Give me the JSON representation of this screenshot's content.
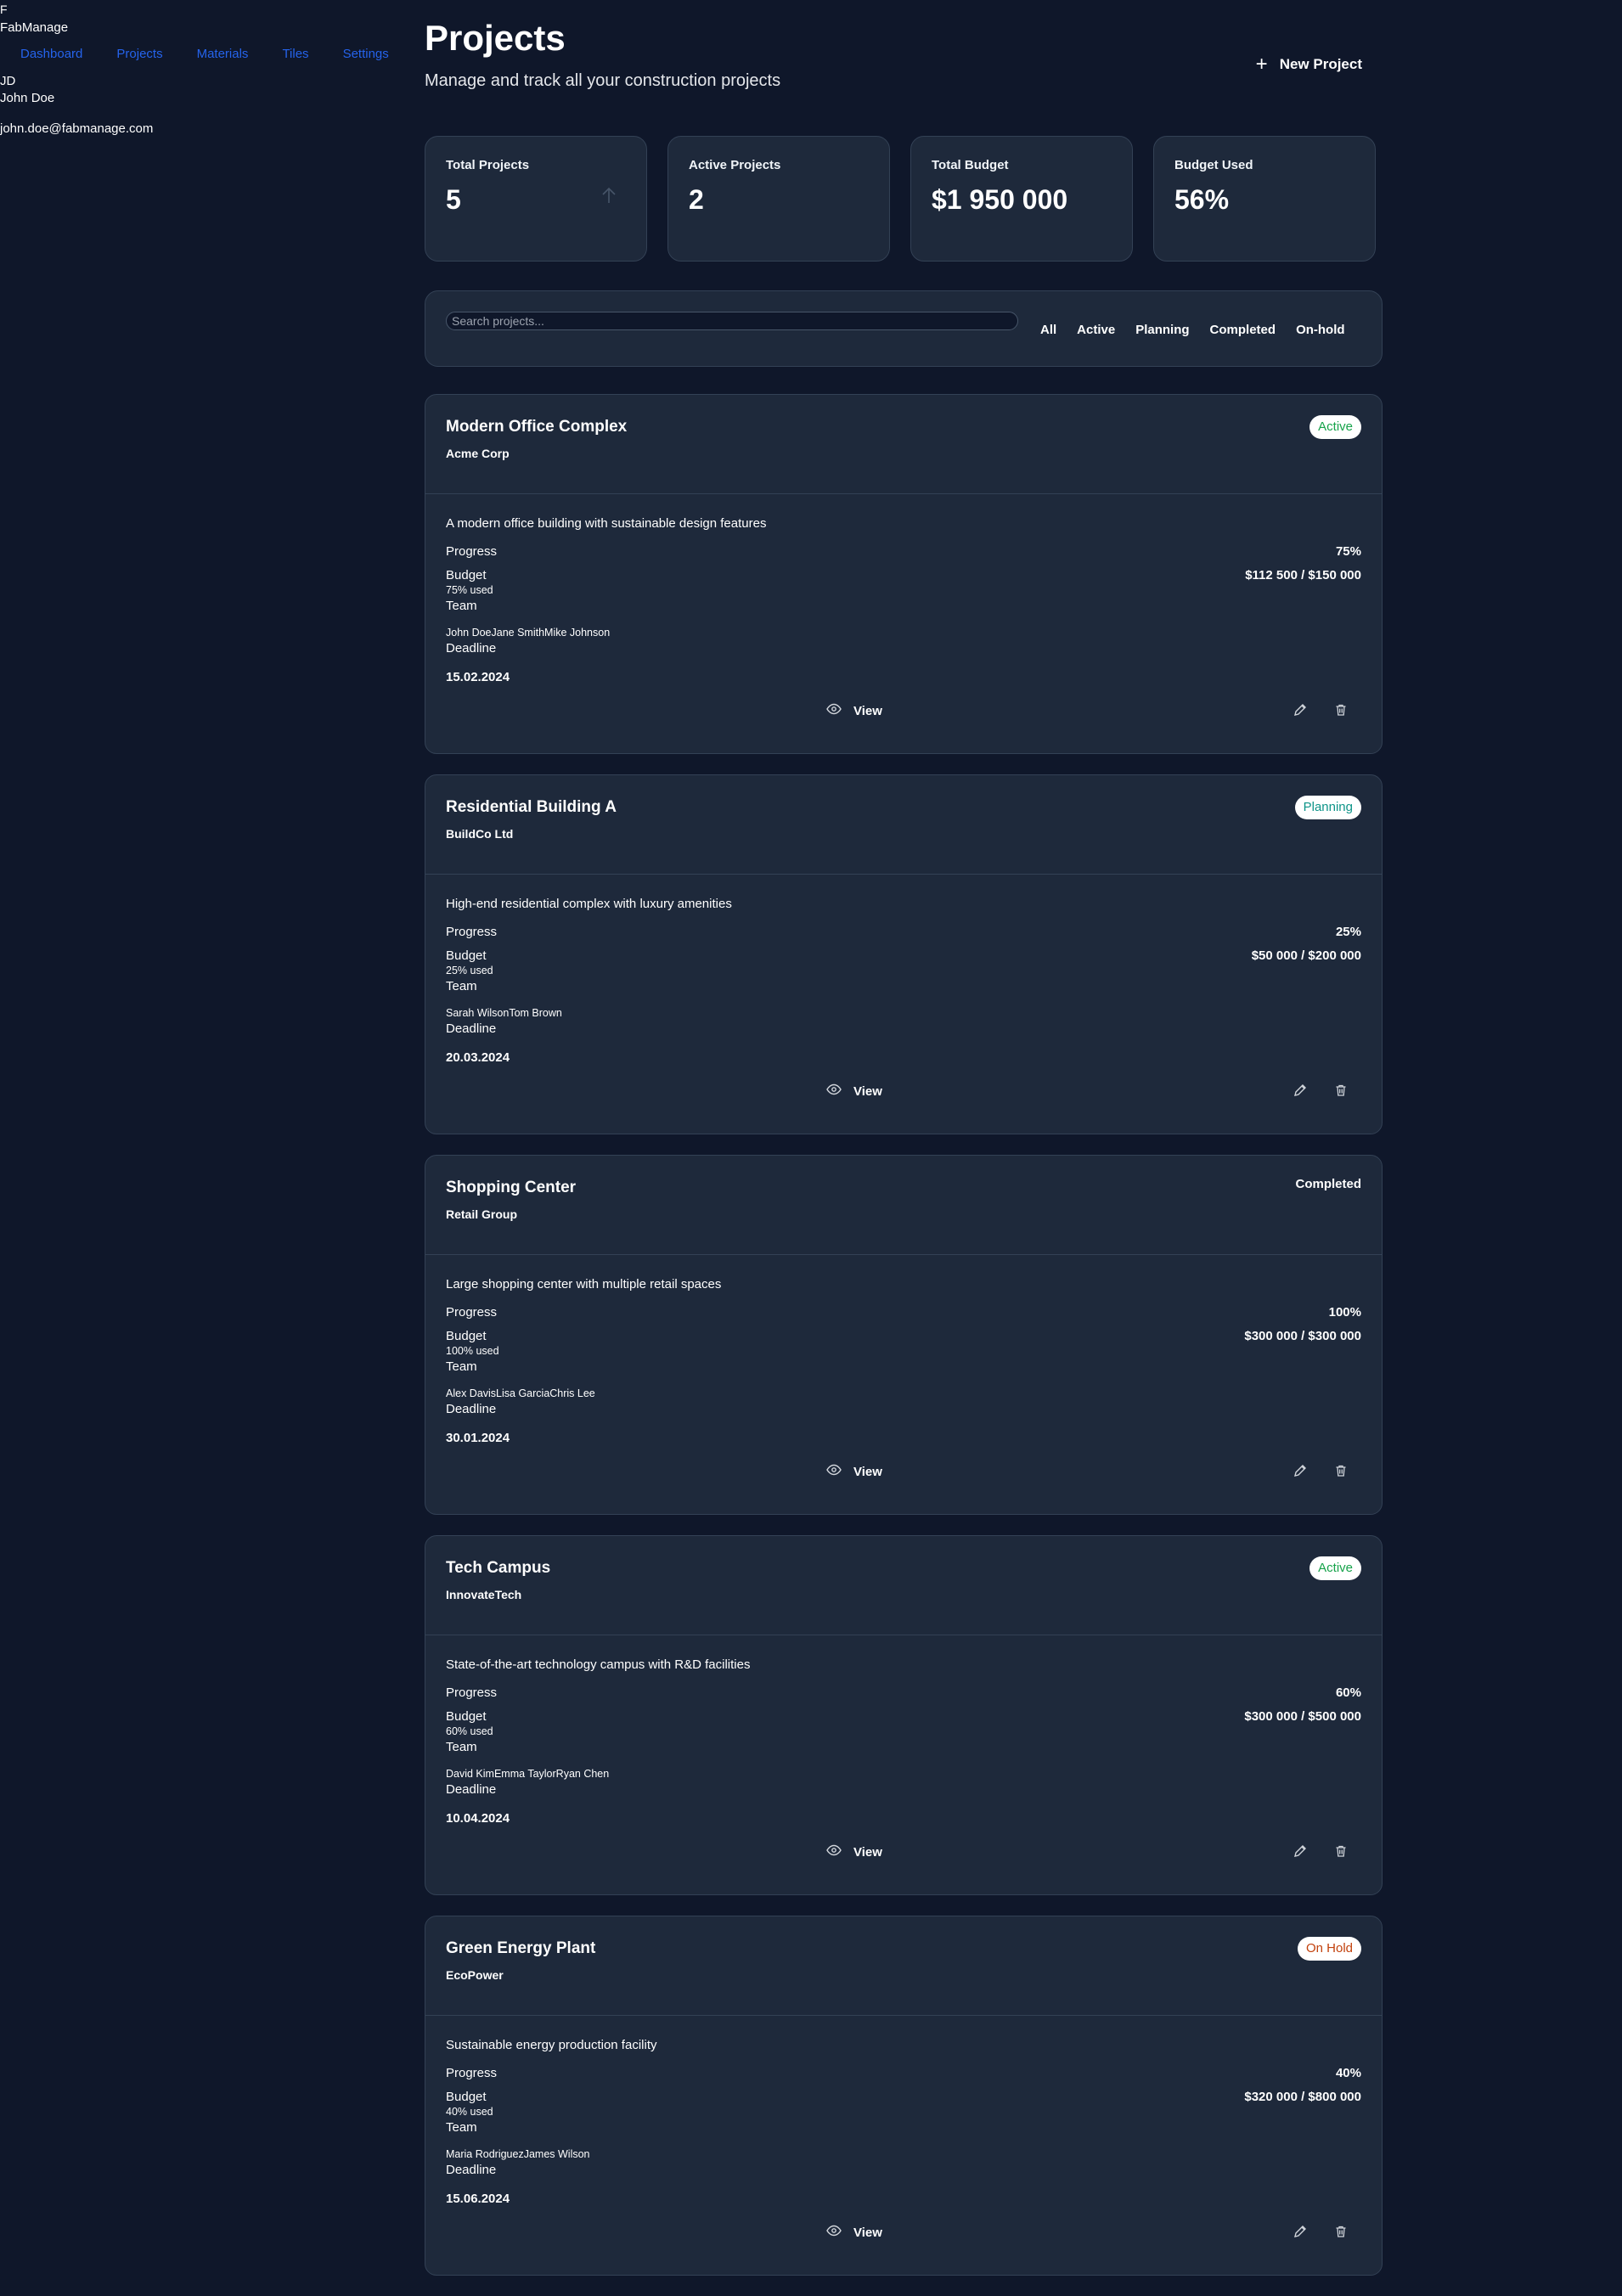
{
  "app": {
    "logo_letter": "F",
    "name": "FabManage"
  },
  "nav": {
    "items": [
      {
        "label": "Dashboard"
      },
      {
        "label": "Projects"
      },
      {
        "label": "Materials"
      },
      {
        "label": "Tiles"
      },
      {
        "label": "Settings"
      }
    ]
  },
  "user": {
    "initials": "JD",
    "name": "John Doe",
    "email": "john.doe@fabmanage.com"
  },
  "header": {
    "title": "Projects",
    "subtitle": "Manage and track all your construction projects",
    "new_button_label": "New Project",
    "new_button_icon": "plus-icon"
  },
  "stats": [
    {
      "label": "Total Projects",
      "value": "5",
      "icon": "arrow-up-icon"
    },
    {
      "label": "Active Projects",
      "value": "2"
    },
    {
      "label": "Total Budget",
      "value": "$1 950 000"
    },
    {
      "label": "Budget Used",
      "value": "56%"
    }
  ],
  "search": {
    "placeholder": "Search projects...",
    "value": ""
  },
  "filters": [
    {
      "label": "All"
    },
    {
      "label": "Active"
    },
    {
      "label": "Planning"
    },
    {
      "label": "Completed"
    },
    {
      "label": "On-hold"
    }
  ],
  "labels": {
    "progress": "Progress",
    "budget": "Budget",
    "team": "Team",
    "deadline": "Deadline",
    "view": "View"
  },
  "colors": {
    "background": "#0f172a",
    "card": "#1e293b",
    "nav_link": "#2563eb",
    "status_active": "#16a34a",
    "status_planning": "#0d9488",
    "status_on_hold": "#c2410c"
  },
  "projects": [
    {
      "title": "Modern Office Complex",
      "client": "Acme Corp",
      "status": "Active",
      "description": "A modern office building with sustainable design features",
      "progress": "75%",
      "budget": "$112 500 / $150 000",
      "budget_used": "75% used",
      "team": "John DoeJane SmithMike Johnson",
      "deadline": "15.02.2024"
    },
    {
      "title": "Residential Building A",
      "client": "BuildCo Ltd",
      "status": "Planning",
      "description": "High-end residential complex with luxury amenities",
      "progress": "25%",
      "budget": "$50 000 / $200 000",
      "budget_used": "25% used",
      "team": "Sarah WilsonTom Brown",
      "deadline": "20.03.2024"
    },
    {
      "title": "Shopping Center",
      "client": "Retail Group",
      "status": "Completed",
      "description": "Large shopping center with multiple retail spaces",
      "progress": "100%",
      "budget": "$300 000 / $300 000",
      "budget_used": "100% used",
      "team": "Alex DavisLisa GarciaChris Lee",
      "deadline": "30.01.2024"
    },
    {
      "title": "Tech Campus",
      "client": "InnovateTech",
      "status": "Active",
      "description": "State-of-the-art technology campus with R&D facilities",
      "progress": "60%",
      "budget": "$300 000 / $500 000",
      "budget_used": "60% used",
      "team": "David KimEmma TaylorRyan Chen",
      "deadline": "10.04.2024"
    },
    {
      "title": "Green Energy Plant",
      "client": "EcoPower",
      "status": "On Hold",
      "description": "Sustainable energy production facility",
      "progress": "40%",
      "budget": "$320 000 / $800 000",
      "budget_used": "40% used",
      "team": "Maria RodriguezJames Wilson",
      "deadline": "15.06.2024"
    }
  ]
}
